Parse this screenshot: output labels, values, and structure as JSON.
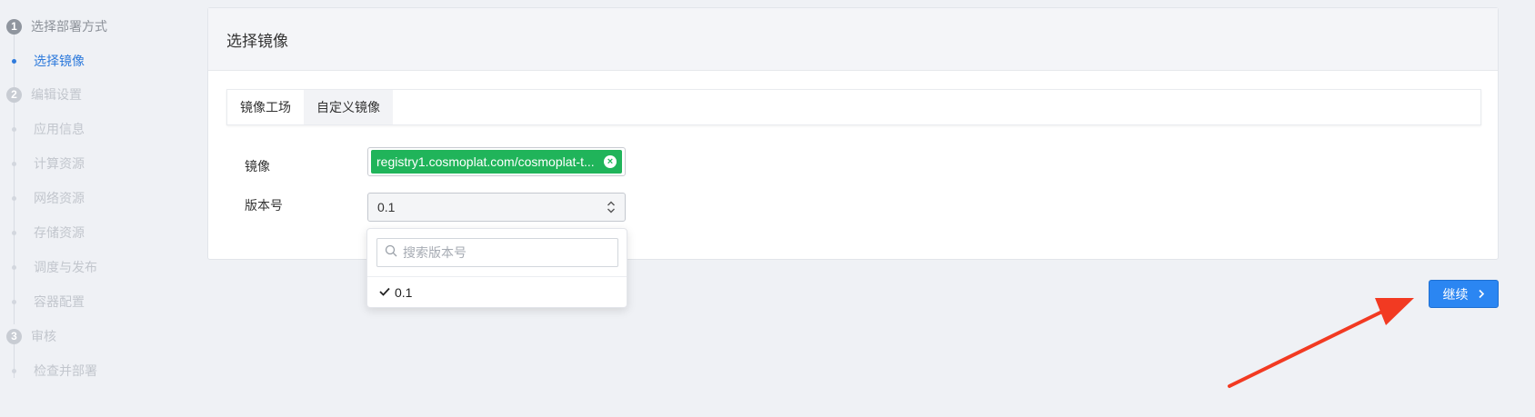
{
  "sidebar": {
    "steps": [
      {
        "number": "1",
        "label": "选择部署方式",
        "sub": [
          {
            "label": "选择镜像",
            "current": true
          }
        ]
      },
      {
        "number": "2",
        "label": "编辑设置",
        "sub": [
          {
            "label": "应用信息"
          },
          {
            "label": "计算资源"
          },
          {
            "label": "网络资源"
          },
          {
            "label": "存储资源"
          },
          {
            "label": "调度与发布"
          },
          {
            "label": "容器配置"
          }
        ]
      },
      {
        "number": "3",
        "label": "审核",
        "sub": [
          {
            "label": "检查并部署"
          }
        ]
      }
    ]
  },
  "card": {
    "title": "选择镜像",
    "tabs": [
      {
        "label": "镜像工场",
        "selected": true
      },
      {
        "label": "自定义镜像",
        "selected": false
      }
    ],
    "form": {
      "image_label": "镜像",
      "image_tag": "registry1.cosmoplat.com/cosmoplat-t...",
      "version_label": "版本号",
      "version_value": "0.1"
    }
  },
  "dropdown": {
    "search_placeholder": "搜索版本号",
    "options": [
      {
        "label": "0.1",
        "selected": true
      }
    ]
  },
  "actions": {
    "continue_label": "继续"
  },
  "colors": {
    "accent": "#2b86f2",
    "tag_green": "#20b45a",
    "annotation_red": "#f23a22"
  }
}
